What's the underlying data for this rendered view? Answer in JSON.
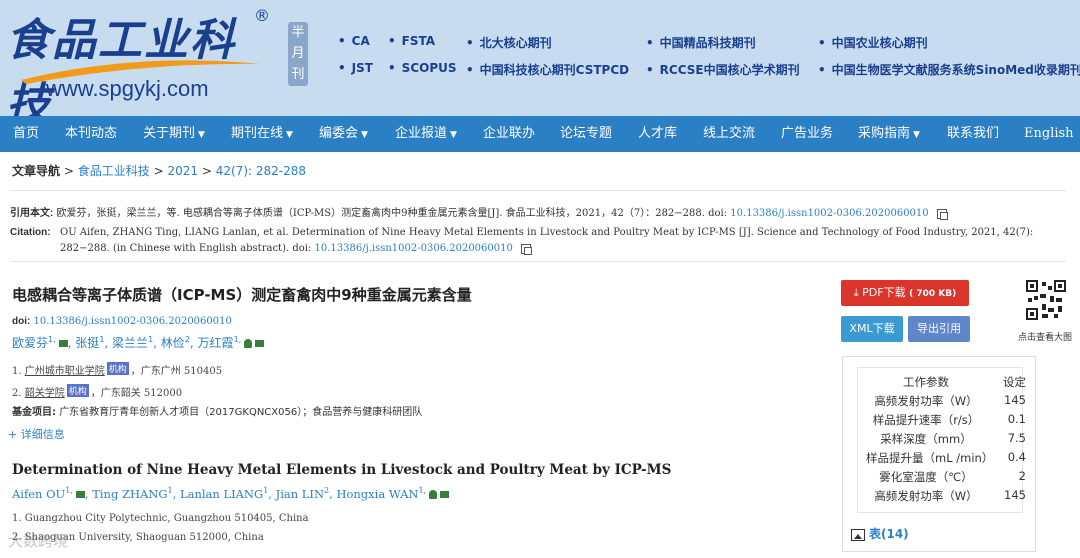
{
  "header": {
    "logo_cn": "食品工业科技",
    "logo_reg": "®",
    "logo_url": "www.spgykj.com",
    "half_month": "半月刊",
    "databases": [
      "CA",
      "FSTA",
      "北大核心期刊",
      "中国精品科技期刊",
      "中国农业核心期刊",
      "JST",
      "SCOPUS",
      "中国科技核心期刊CSTPCD",
      "RCCSE中国核心学术期刊",
      "中国生物医学文献服务系统SinoMed收录期刊"
    ]
  },
  "nav": {
    "items": [
      "首页",
      "本刊动态",
      "关于期刊",
      "期刊在线",
      "编委会",
      "企业报道",
      "企业联办",
      "论坛专题",
      "人才库",
      "线上交流",
      "广告业务",
      "采购指南",
      "联系我们",
      "English"
    ]
  },
  "breadcrumb": {
    "label": "文章导航",
    "sep": ">",
    "journal": "食品工业科技",
    "year": "2021",
    "issue": "42(7): 282-288"
  },
  "citation": {
    "cn_label": "引用本文:",
    "cn_text": "欧爱芬，张挺，梁兰兰，等. 电感耦合等离子体质谱（ICP-MS）测定畜禽肉中9种重金属元素含量[J]. 食品工业科技，2021，42（7）：282−288. doi:",
    "doi": "10.13386/j.issn1002-0306.2020060010",
    "en_label": "Citation:",
    "en_text": "OU Aifen, ZHANG Ting, LIANG Lanlan, et al. Determination of Nine Heavy Metal Elements in Livestock and Poultry Meat by ICP-MS [J]. Science and Technology of Food Industry, 2021, 42(7): 282−288. doi:",
    "en_tail": "(in Chinese with English abstract). doi:"
  },
  "article": {
    "title_cn": "电感耦合等离子体质谱（ICP-MS）测定畜禽肉中9种重金属元素含量",
    "doi_label": "doi:",
    "doi": "10.13386/j.issn1002-0306.2020060010",
    "authors_cn": [
      "欧爱芬",
      "张挺",
      "梁兰兰",
      "林俭",
      "万红霞"
    ],
    "author_sups": [
      "1,",
      "1",
      "1",
      "2",
      "1,"
    ],
    "aff1_num": "1.",
    "aff1_org": "广州城市职业学院",
    "aff1_tag": "机构",
    "aff1_loc": "，广东广州 510405",
    "aff2_num": "2.",
    "aff2_org": "韶关学院",
    "aff2_tag": "机构",
    "aff2_loc": "，广东韶关 512000",
    "fund_label": "基金项目:",
    "fund_text": "广东省教育厅青年创新人才项目（2017GKQNCX056）；食品营养与健康科研团队",
    "more": "+ 详细信息",
    "title_en": "Determination of Nine Heavy Metal Elements in Livestock and Poultry Meat by ICP-MS",
    "authors_en": [
      "Aifen OU",
      "Ting ZHANG",
      "Lanlan LIANG",
      "Jian LIN",
      "Hongxia WAN"
    ],
    "author_en_sups": [
      "1,",
      "1",
      "1",
      "2",
      "1,"
    ],
    "aff_en1": "1.  Guangzhou City Polytechnic, Guangzhou 510405, China",
    "aff_en2": "2.  Shaoguan University, Shaoguan 512000, China"
  },
  "sidebar": {
    "pdf_label": "PDF下载",
    "pdf_size": "( 700 KB)",
    "xml_label": "XML下载",
    "export_label": "导出引用",
    "qr_caption": "点击查看大图",
    "table_header": [
      "工作参数",
      "设定"
    ],
    "table_rows": [
      [
        "高频发射功率（W）",
        "145"
      ],
      [
        "样品提升速率（r/s）",
        "0.1"
      ],
      [
        "采样深度（mm）",
        "7.5"
      ],
      [
        "样品提升量（mL /min）",
        "0.4"
      ],
      [
        "雾化室温度（℃）",
        "2"
      ],
      [
        "高频发射功率（W）",
        "145"
      ]
    ],
    "tables_link": "表(14)"
  },
  "watermark": "大数跨境"
}
